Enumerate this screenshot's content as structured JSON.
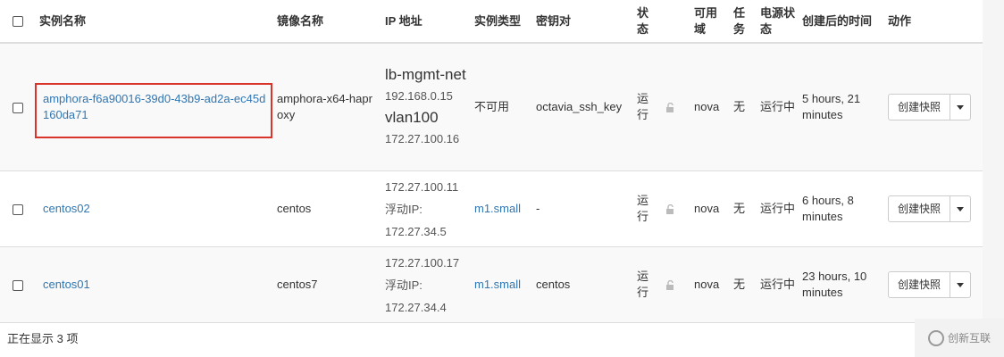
{
  "table": {
    "headers": {
      "name": "实例名称",
      "image": "镜像名称",
      "ip": "IP 地址",
      "flavor": "实例类型",
      "keypair": "密钥对",
      "status": "状态",
      "az": "可用域",
      "task": "任务",
      "power": "电源状态",
      "age": "创建后的时间",
      "actions": "动作"
    },
    "rows": [
      {
        "name": "amphora-f6a90016-39d0-43b9-ad2a-ec45d160da71",
        "image": "amphora-x64-haproxy",
        "ip": [
          {
            "net": "lb-mgmt-net",
            "addr": "192.168.0.15"
          },
          {
            "net": "vlan100",
            "addr": "172.27.100.16"
          }
        ],
        "flavor": "不可用",
        "keypair": "octavia_ssh_key",
        "status": "运行",
        "az": "nova",
        "task": "无",
        "power": "运行中",
        "age": "5 hours, 21 minutes",
        "action": "创建快照"
      },
      {
        "name": "centos02",
        "image": "centos",
        "ip_lines": [
          "172.27.100.11",
          "浮动IP:",
          "172.27.34.5"
        ],
        "flavor": "m1.small",
        "keypair": "-",
        "status": "运行",
        "az": "nova",
        "task": "无",
        "power": "运行中",
        "age": "6 hours, 8 minutes",
        "action": "创建快照"
      },
      {
        "name": "centos01",
        "image": "centos7",
        "ip_lines": [
          "172.27.100.17",
          "浮动IP:",
          "172.27.34.4"
        ],
        "flavor": "m1.small",
        "keypair": "centos",
        "status": "运行",
        "az": "nova",
        "task": "无",
        "power": "运行中",
        "age": "23 hours, 10 minutes",
        "action": "创建快照"
      }
    ]
  },
  "footer": {
    "count_text": "正在显示 3 项"
  },
  "watermark": {
    "text": "创新互联"
  },
  "colors": {
    "link": "#3176b1",
    "highlight": "#d9332b"
  }
}
